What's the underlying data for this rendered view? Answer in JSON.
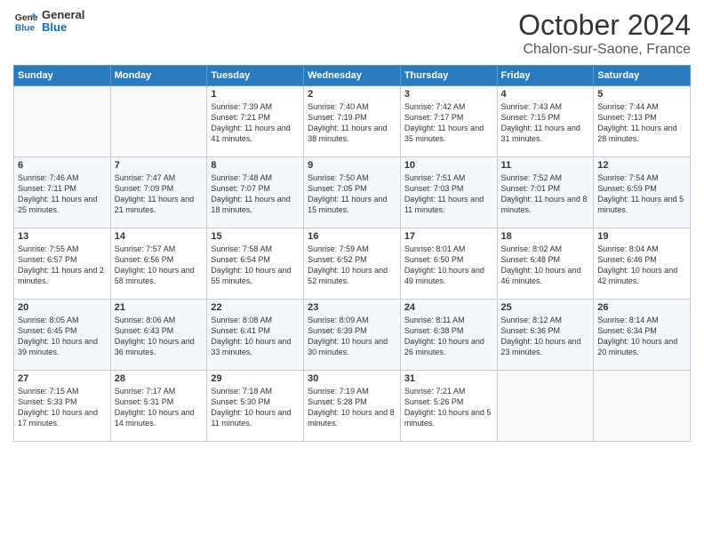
{
  "header": {
    "logo_line1": "General",
    "logo_line2": "Blue",
    "title": "October 2024",
    "subtitle": "Chalon-sur-Saone, France"
  },
  "days_of_week": [
    "Sunday",
    "Monday",
    "Tuesday",
    "Wednesday",
    "Thursday",
    "Friday",
    "Saturday"
  ],
  "weeks": [
    [
      {
        "day": "",
        "info": ""
      },
      {
        "day": "",
        "info": ""
      },
      {
        "day": "1",
        "info": "Sunrise: 7:39 AM\nSunset: 7:21 PM\nDaylight: 11 hours and 41 minutes."
      },
      {
        "day": "2",
        "info": "Sunrise: 7:40 AM\nSunset: 7:19 PM\nDaylight: 11 hours and 38 minutes."
      },
      {
        "day": "3",
        "info": "Sunrise: 7:42 AM\nSunset: 7:17 PM\nDaylight: 11 hours and 35 minutes."
      },
      {
        "day": "4",
        "info": "Sunrise: 7:43 AM\nSunset: 7:15 PM\nDaylight: 11 hours and 31 minutes."
      },
      {
        "day": "5",
        "info": "Sunrise: 7:44 AM\nSunset: 7:13 PM\nDaylight: 11 hours and 28 minutes."
      }
    ],
    [
      {
        "day": "6",
        "info": "Sunrise: 7:46 AM\nSunset: 7:11 PM\nDaylight: 11 hours and 25 minutes."
      },
      {
        "day": "7",
        "info": "Sunrise: 7:47 AM\nSunset: 7:09 PM\nDaylight: 11 hours and 21 minutes."
      },
      {
        "day": "8",
        "info": "Sunrise: 7:48 AM\nSunset: 7:07 PM\nDaylight: 11 hours and 18 minutes."
      },
      {
        "day": "9",
        "info": "Sunrise: 7:50 AM\nSunset: 7:05 PM\nDaylight: 11 hours and 15 minutes."
      },
      {
        "day": "10",
        "info": "Sunrise: 7:51 AM\nSunset: 7:03 PM\nDaylight: 11 hours and 11 minutes."
      },
      {
        "day": "11",
        "info": "Sunrise: 7:52 AM\nSunset: 7:01 PM\nDaylight: 11 hours and 8 minutes."
      },
      {
        "day": "12",
        "info": "Sunrise: 7:54 AM\nSunset: 6:59 PM\nDaylight: 11 hours and 5 minutes."
      }
    ],
    [
      {
        "day": "13",
        "info": "Sunrise: 7:55 AM\nSunset: 6:57 PM\nDaylight: 11 hours and 2 minutes."
      },
      {
        "day": "14",
        "info": "Sunrise: 7:57 AM\nSunset: 6:56 PM\nDaylight: 10 hours and 58 minutes."
      },
      {
        "day": "15",
        "info": "Sunrise: 7:58 AM\nSunset: 6:54 PM\nDaylight: 10 hours and 55 minutes."
      },
      {
        "day": "16",
        "info": "Sunrise: 7:59 AM\nSunset: 6:52 PM\nDaylight: 10 hours and 52 minutes."
      },
      {
        "day": "17",
        "info": "Sunrise: 8:01 AM\nSunset: 6:50 PM\nDaylight: 10 hours and 49 minutes."
      },
      {
        "day": "18",
        "info": "Sunrise: 8:02 AM\nSunset: 6:48 PM\nDaylight: 10 hours and 46 minutes."
      },
      {
        "day": "19",
        "info": "Sunrise: 8:04 AM\nSunset: 6:46 PM\nDaylight: 10 hours and 42 minutes."
      }
    ],
    [
      {
        "day": "20",
        "info": "Sunrise: 8:05 AM\nSunset: 6:45 PM\nDaylight: 10 hours and 39 minutes."
      },
      {
        "day": "21",
        "info": "Sunrise: 8:06 AM\nSunset: 6:43 PM\nDaylight: 10 hours and 36 minutes."
      },
      {
        "day": "22",
        "info": "Sunrise: 8:08 AM\nSunset: 6:41 PM\nDaylight: 10 hours and 33 minutes."
      },
      {
        "day": "23",
        "info": "Sunrise: 8:09 AM\nSunset: 6:39 PM\nDaylight: 10 hours and 30 minutes."
      },
      {
        "day": "24",
        "info": "Sunrise: 8:11 AM\nSunset: 6:38 PM\nDaylight: 10 hours and 26 minutes."
      },
      {
        "day": "25",
        "info": "Sunrise: 8:12 AM\nSunset: 6:36 PM\nDaylight: 10 hours and 23 minutes."
      },
      {
        "day": "26",
        "info": "Sunrise: 8:14 AM\nSunset: 6:34 PM\nDaylight: 10 hours and 20 minutes."
      }
    ],
    [
      {
        "day": "27",
        "info": "Sunrise: 7:15 AM\nSunset: 5:33 PM\nDaylight: 10 hours and 17 minutes."
      },
      {
        "day": "28",
        "info": "Sunrise: 7:17 AM\nSunset: 5:31 PM\nDaylight: 10 hours and 14 minutes."
      },
      {
        "day": "29",
        "info": "Sunrise: 7:18 AM\nSunset: 5:30 PM\nDaylight: 10 hours and 11 minutes."
      },
      {
        "day": "30",
        "info": "Sunrise: 7:19 AM\nSunset: 5:28 PM\nDaylight: 10 hours and 8 minutes."
      },
      {
        "day": "31",
        "info": "Sunrise: 7:21 AM\nSunset: 5:26 PM\nDaylight: 10 hours and 5 minutes."
      },
      {
        "day": "",
        "info": ""
      },
      {
        "day": "",
        "info": ""
      }
    ]
  ]
}
